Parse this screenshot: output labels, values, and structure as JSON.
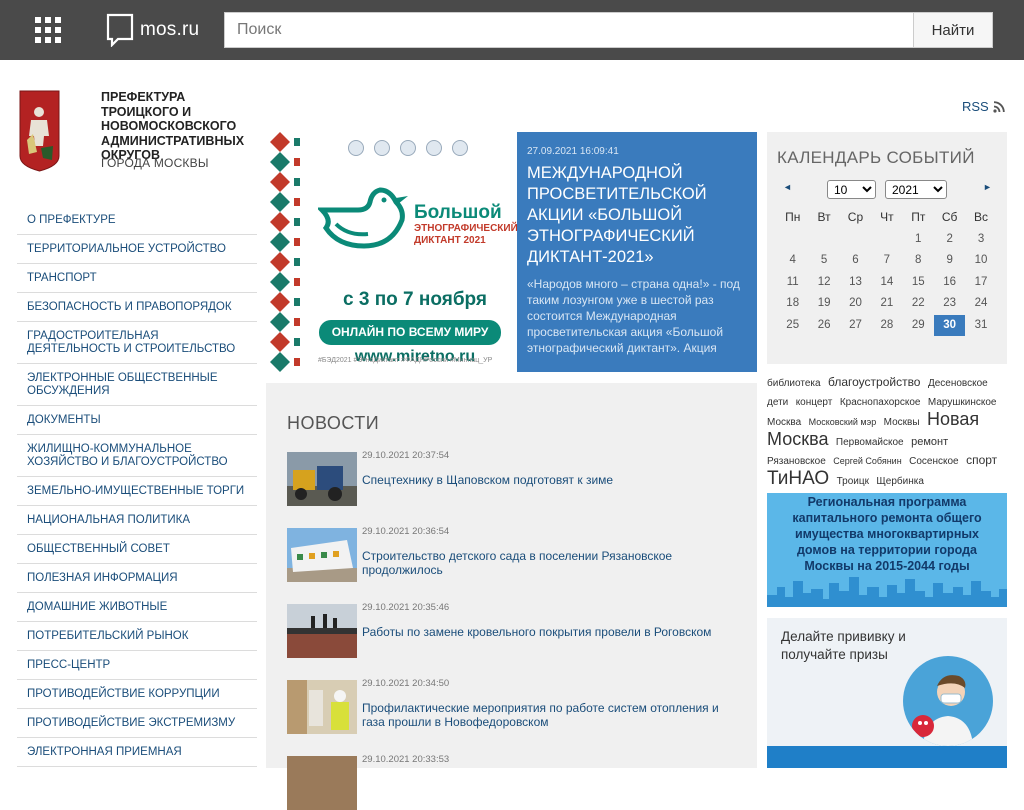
{
  "topbar": {
    "site_name": "mos.ru",
    "search_placeholder": "Поиск",
    "search_button": "Найти"
  },
  "header": {
    "org_title": "Префектура Троицкого и Новомосковского административных округов",
    "org_subtitle": "города Москвы",
    "rss_label": "RSS"
  },
  "menu": [
    "О префектуре",
    "Территориальное устройство",
    "Транспорт",
    "Безопасность и правопорядок",
    "Градостроительная деятельность и строительство",
    "Электронные общественные обсуждения",
    "Документы",
    "Жилищно-коммунальное хозяйство и благоустройство",
    "Земельно-имущественные торги",
    "Национальная политика",
    "Общественный совет",
    "Полезная информация",
    "Домашние животные",
    "Потребительский рынок",
    "Пресс-центр",
    "Противодействие коррупции",
    "Противодействие экстремизму",
    "Электронная приемная"
  ],
  "banner": {
    "image": {
      "title_big": "Большой",
      "title_small": "Этнографический диктант 2021",
      "dates": "с 3 по 7 ноября",
      "online": "ОНЛАЙН ПО ВСЕМУ МИРУ",
      "site": "www.miretno.ru",
      "tags": "#БЭД2021 #ЭтноДиктант #ФАДНРоссии #Миннац_УР"
    },
    "date": "27.09.2021 16:09:41",
    "title": "Международной просветительской акции «Большой этнографический диктант-2021»",
    "description": "«Народов много – страна одна!» - под таким лозунгом уже в шестой раз состоится Международная просветительская акция «Большой этнографический диктант». Акция"
  },
  "news": {
    "heading": "Новости",
    "items": [
      {
        "date": "29.10.2021 20:37:54",
        "title": "Спецтехнику в Щаповском подготовят к зиме"
      },
      {
        "date": "29.10.2021 20:36:54",
        "title": "Строительство детского сада в поселении Рязановское продолжилось"
      },
      {
        "date": "29.10.2021 20:35:46",
        "title": "Работы по замене кровельного покрытия провели в Роговском"
      },
      {
        "date": "29.10.2021 20:34:50",
        "title": "Профилактические мероприятия по работе систем отопления и газа прошли в Новофедоровском"
      },
      {
        "date": "29.10.2021 20:33:53",
        "title": ""
      }
    ]
  },
  "calendar": {
    "heading": "Календарь событий",
    "month": "10",
    "year": "2021",
    "prev": "◄",
    "next": "►",
    "weekdays": [
      "Пн",
      "Вт",
      "Ср",
      "Чт",
      "Пт",
      "Сб",
      "Вс"
    ],
    "weeks": [
      [
        "",
        "",
        "",
        "",
        "1",
        "2",
        "3"
      ],
      [
        "4",
        "5",
        "6",
        "7",
        "8",
        "9",
        "10"
      ],
      [
        "11",
        "12",
        "13",
        "14",
        "15",
        "16",
        "17"
      ],
      [
        "18",
        "19",
        "20",
        "21",
        "22",
        "23",
        "24"
      ],
      [
        "25",
        "26",
        "27",
        "28",
        "29",
        "30",
        "31"
      ]
    ],
    "today": "30"
  },
  "tags": [
    {
      "text": "библиотека",
      "size": 10
    },
    {
      "text": "благоустройство",
      "size": 12
    },
    {
      "text": "Десеновское",
      "size": 10
    },
    {
      "text": "дети",
      "size": 10
    },
    {
      "text": "концерт",
      "size": 10
    },
    {
      "text": "Краснопахорское",
      "size": 10
    },
    {
      "text": "Марушкинское",
      "size": 10
    },
    {
      "text": "Москва",
      "size": 10
    },
    {
      "text": "Московский мэр",
      "size": 9
    },
    {
      "text": "Москвы",
      "size": 10
    },
    {
      "text": "Новая Москва",
      "size": 18
    },
    {
      "text": "Первомайское",
      "size": 10
    },
    {
      "text": "ремонт",
      "size": 11
    },
    {
      "text": "Рязановское",
      "size": 10
    },
    {
      "text": "Сергей Собянин",
      "size": 9
    },
    {
      "text": "Сосенское",
      "size": 10
    },
    {
      "text": "спорт",
      "size": 12
    },
    {
      "text": "ТиНАО",
      "size": 19
    },
    {
      "text": "Троицк",
      "size": 10
    },
    {
      "text": "Щербинка",
      "size": 10
    }
  ],
  "promo1": "Региональная программа капитального ремонта общего имущества многоквартирных домов на территории города Москвы на 2015-2044 годы",
  "promo2": "Делайте прививку и получайте призы",
  "colors": {
    "topbar": "#4a4a4a",
    "link": "#1a4d7a",
    "banner_blue": "#3a7bbd",
    "panel_gray": "#f0f0f0",
    "accent_green": "#0b8a78"
  }
}
